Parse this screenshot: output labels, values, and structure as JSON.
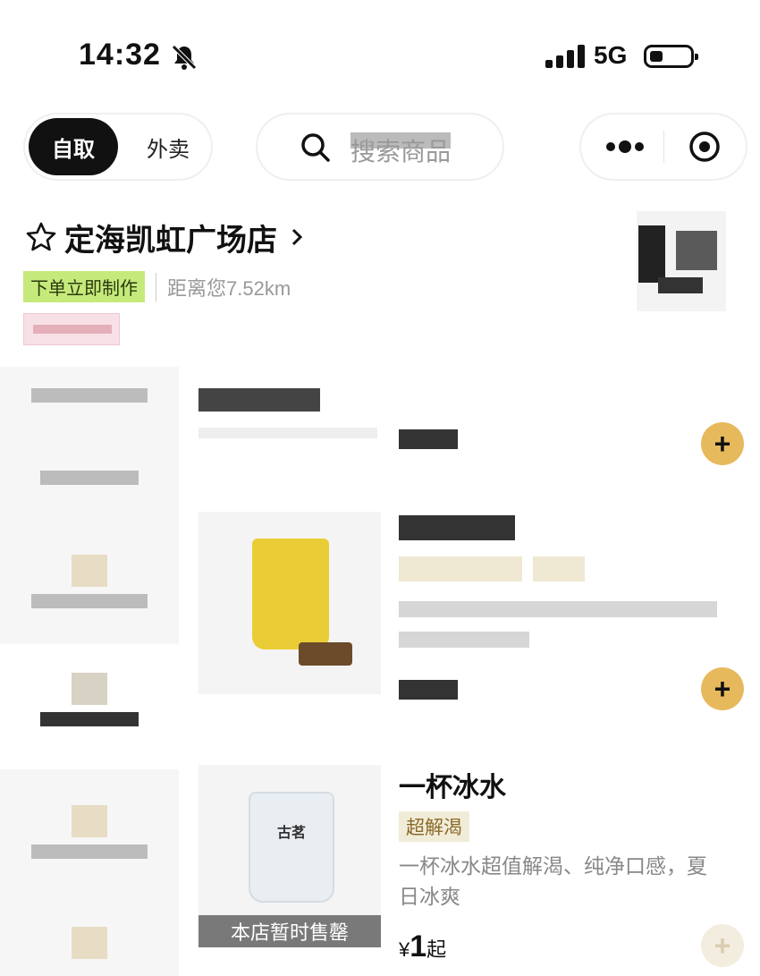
{
  "status_bar": {
    "time": "14:32",
    "network": "5G"
  },
  "header": {
    "modes": [
      {
        "label": "自取",
        "active": true
      },
      {
        "label": "外卖",
        "active": false
      }
    ],
    "search_placeholder": "搜索商品"
  },
  "store": {
    "name": "定海凯虹广场店",
    "status_tag": "下单立即制作",
    "distance": "距离您7.52km"
  },
  "menu": {
    "items": [
      {
        "name": "一杯冰水",
        "tag": "超解渴",
        "desc_line1": "一杯冰水超值解渴、纯净口感，夏",
        "desc_line2": "日冰爽",
        "currency": "¥",
        "price": "1",
        "price_suffix": "起",
        "status": "本店暂时售罄",
        "image_brand": "古茗"
      }
    ]
  },
  "colors": {
    "accent": "#e7b95d",
    "tag_green": "#c5ea7b",
    "dark": "#111111"
  }
}
